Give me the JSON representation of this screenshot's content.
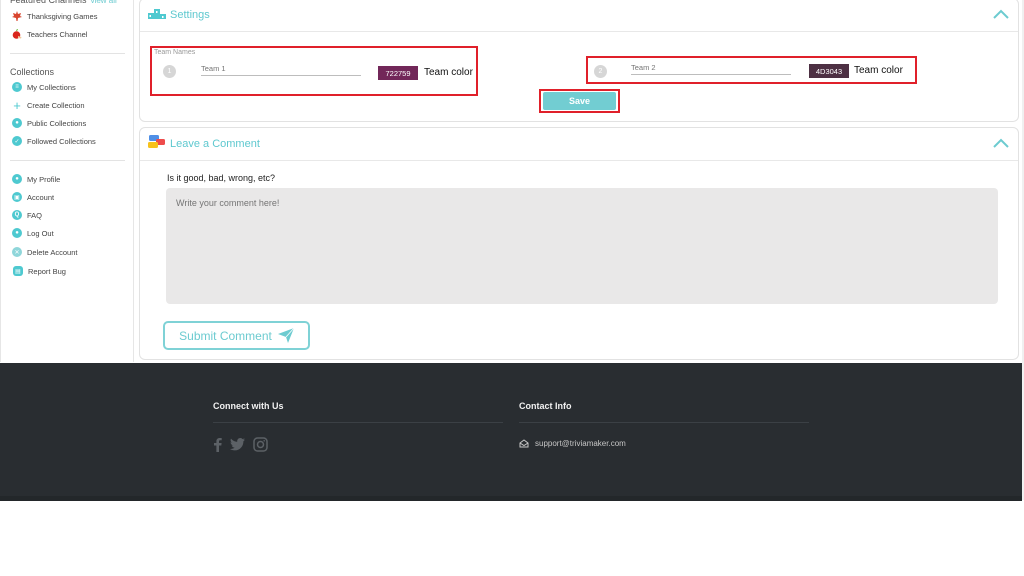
{
  "sidebar": {
    "featured_heading": "Featured Channels",
    "view_all": "view all",
    "featured": [
      {
        "label": "Thanksgiving Games",
        "icon": "maple-leaf-icon"
      },
      {
        "label": "Teachers Channel",
        "icon": "apple-icon"
      }
    ],
    "collections_heading": "Collections",
    "collections": [
      {
        "label": "My Collections",
        "icon": "list-icon"
      },
      {
        "label": "Create Collection",
        "icon": "plus-icon"
      },
      {
        "label": "Public Collections",
        "icon": "group-icon"
      },
      {
        "label": "Followed Collections",
        "icon": "check-icon"
      }
    ],
    "account_items": [
      {
        "label": "My Profile",
        "icon": "user-icon"
      },
      {
        "label": "Account",
        "icon": "account-icon"
      },
      {
        "label": "FAQ",
        "icon": "faq-icon"
      },
      {
        "label": "Log Out",
        "icon": "logout-icon"
      },
      {
        "label": "Delete Account",
        "icon": "delete-account-icon"
      },
      {
        "label": "Report Bug",
        "icon": "bug-report-icon"
      }
    ]
  },
  "settings": {
    "title": "Settings",
    "team_names_label": "Team Names",
    "teams": [
      {
        "number": "1",
        "placeholder": "Team 1",
        "color_hex": "722759",
        "color": "#722759",
        "color_label": "Team color"
      },
      {
        "number": "2",
        "placeholder": "Team 2",
        "color_hex": "4D3043",
        "color": "#4D3043",
        "color_label": "Team color"
      }
    ],
    "save_label": "Save"
  },
  "comment": {
    "title": "Leave a Comment",
    "question": "Is it good, bad, wrong, etc?",
    "placeholder": "Write your comment here!",
    "submit_label": "Submit Comment"
  },
  "footer": {
    "connect_heading": "Connect with Us",
    "social": [
      "facebook-icon",
      "twitter-icon",
      "instagram-icon"
    ],
    "contact_heading": "Contact Info",
    "email": "support@triviamaker.com"
  },
  "colors": {
    "accent": "#5ec8cf",
    "highlight": "#e0202a",
    "footer_bg": "#292d31"
  }
}
